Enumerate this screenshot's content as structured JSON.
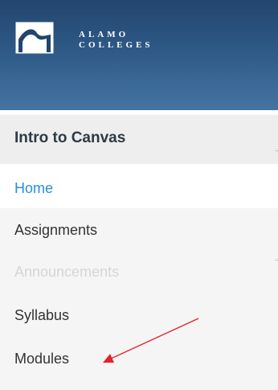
{
  "header": {
    "brand_line1": "ALAMO",
    "brand_line2": "COLLEGES",
    "logo_icon": "alamo-arch-logo",
    "colors": {
      "top": "#23456e",
      "bottom": "#4574a2"
    }
  },
  "course": {
    "title": "Intro to Canvas"
  },
  "nav": {
    "items": [
      {
        "label": "Home",
        "state": "active"
      },
      {
        "label": "Assignments",
        "state": "normal"
      },
      {
        "label": "Announcements",
        "state": "disabled"
      },
      {
        "label": "Syllabus",
        "state": "normal"
      },
      {
        "label": "Modules",
        "state": "normal"
      }
    ],
    "colors": {
      "active_text": "#2a8fcf",
      "text": "#333333",
      "disabled_text": "#d6d6d6"
    }
  },
  "annotation": {
    "arrow_color": "#e8202a",
    "arrow_points_to": "Modules"
  }
}
